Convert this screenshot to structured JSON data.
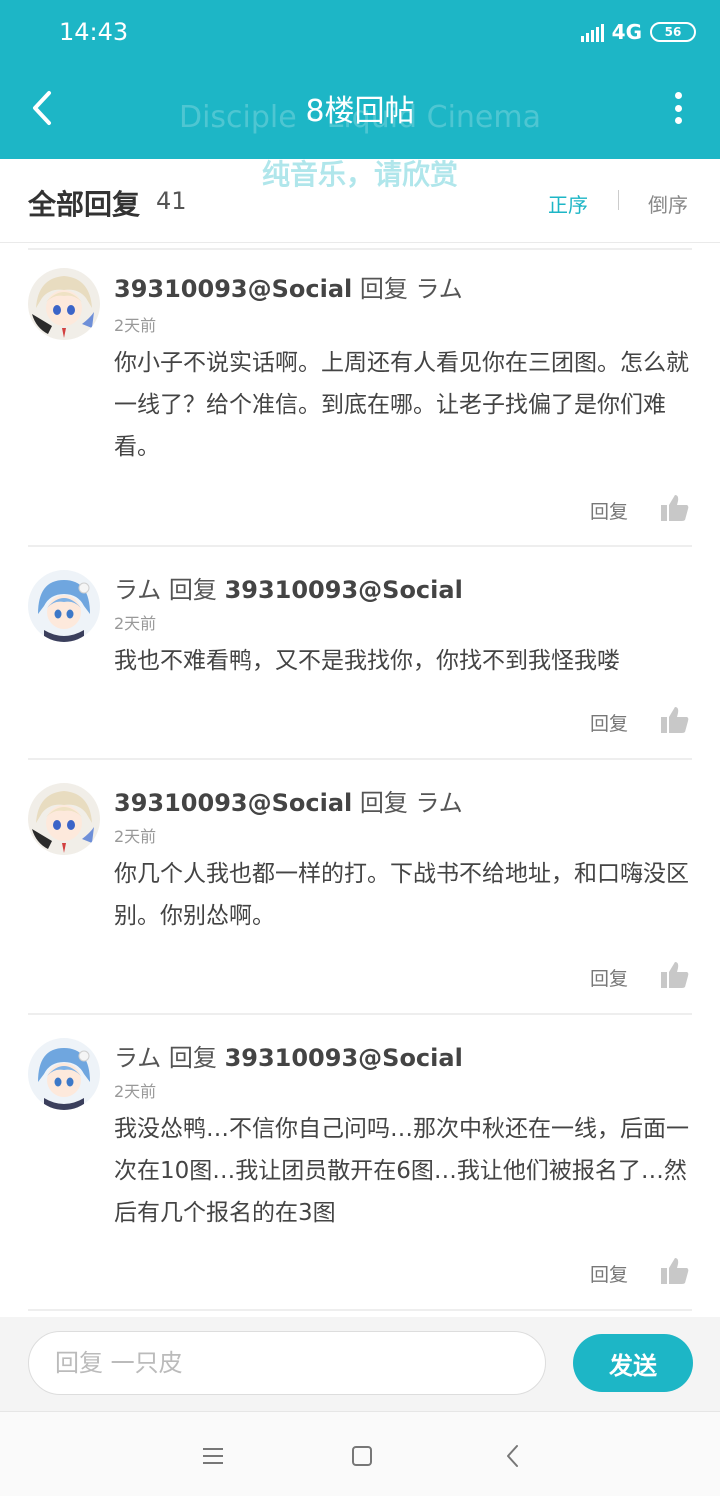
{
  "status_bar": {
    "time": "14:43",
    "network": "4G",
    "battery": "56"
  },
  "header": {
    "title": "8楼回帖"
  },
  "overlay": {
    "line1": "Disciple - Liquid Cinema",
    "line2": "纯音乐，请欣赏"
  },
  "subheader": {
    "title": "全部回复",
    "count": "41",
    "sort_asc": "正序",
    "sort_desc": "倒序"
  },
  "comments": [
    {
      "user": "39310093@Social",
      "verb": "回复",
      "target": "ラム",
      "time": "2天前",
      "text": "你小子不说实话啊。上周还有人看见你在三团图。怎么就一线了？给个准信。到底在哪。让老子找偏了是你们难看。",
      "reply_label": "回复"
    },
    {
      "user": "ラム",
      "verb": "回复",
      "target": "39310093@Social",
      "time": "2天前",
      "text": "我也不难看鸭，又不是我找你，你找不到我怪我喽",
      "reply_label": "回复"
    },
    {
      "user": "39310093@Social",
      "verb": "回复",
      "target": "ラム",
      "time": "2天前",
      "text": "你几个人我也都一样的打。下战书不给地址，和口嗨没区别。你别怂啊。",
      "reply_label": "回复"
    },
    {
      "user": "ラム",
      "verb": "回复",
      "target": "39310093@Social",
      "time": "2天前",
      "text": "我没怂鸭…不信你自己问吗…那次中秋还在一线，后面一次在10图…我让团员散开在6图…我让他们被报名了…然后有几个报名的在3图",
      "reply_label": "回复"
    }
  ],
  "input": {
    "placeholder": "回复 一只皮",
    "send_label": "发送"
  },
  "colors": {
    "accent": "#1DB6C6"
  }
}
